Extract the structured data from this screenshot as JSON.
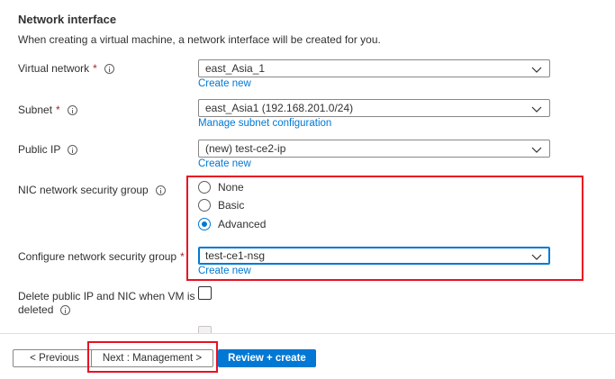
{
  "section": {
    "title": "Network interface",
    "description": "When creating a virtual machine, a network interface will be created for you."
  },
  "virtual_network": {
    "label": "Virtual network",
    "required_mark": "*",
    "value": "east_Asia_1",
    "link": "Create new"
  },
  "subnet": {
    "label": "Subnet",
    "required_mark": "*",
    "value": "east_Asia1 (192.168.201.0/24)",
    "link": "Manage subnet configuration"
  },
  "public_ip": {
    "label": "Public IP",
    "value": "(new) test-ce2-ip",
    "link": "Create new"
  },
  "nic_nsg": {
    "label": "NIC network security group",
    "options": [
      "None",
      "Basic",
      "Advanced"
    ],
    "selected": "Advanced"
  },
  "configure_nsg": {
    "label": "Configure network security group",
    "required_mark": "*",
    "value": "test-ce1-nsg",
    "link": "Create new"
  },
  "delete_public_ip": {
    "label_line1": "Delete public IP and NIC when VM is",
    "label_line2": "deleted"
  },
  "footer": {
    "previous": "< Previous",
    "next": "Next : Management >",
    "review": "Review + create"
  },
  "colors": {
    "accent": "#0078d4",
    "highlight": "#e81123",
    "required": "#a4262c"
  }
}
